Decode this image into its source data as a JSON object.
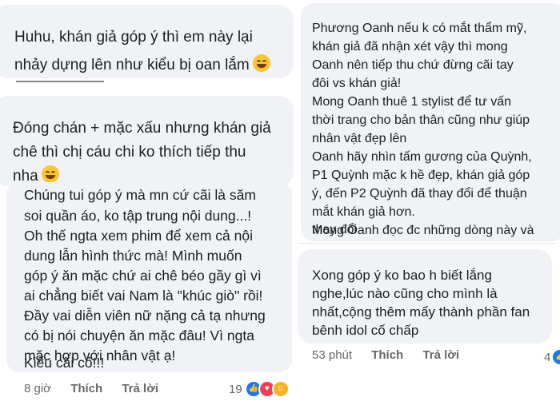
{
  "left": {
    "comment1": {
      "lines": [
        "Huhu, khán giả góp ý thì em này lại",
        "nhảy dựng lên như kiểu bị oan lắm"
      ]
    },
    "comment2": {
      "lines": [
        "Đóng chán + mặc xấu nhưng khán giả",
        "chê thì chị cáu chi ko thích tiếp thu",
        "nha"
      ]
    },
    "comment3": {
      "lines": [
        "Chúng tui góp ý mà mn cứ cãi là săm",
        "soi quần áo, ko tập trung nội dung...!",
        "Oh thế ngta xem phim để xem cả nội",
        "dung lẫn hình thức mà! Mình muốn",
        "góp ý ăn mặc chứ ai chê béo gầy gì vì",
        "ai chẳng biết vai Nam là \"khúc giò\" rồi!",
        "Đầy vai diễn viên nữ nặng cả tạ nhưng",
        "có bị nói chuyện ăn mặc đâu! Vì ngta",
        "mặc hợp với nhân vật ạ!",
        "Kiểu cãi cố!!!"
      ],
      "meta": {
        "time": "8 giờ",
        "like": "Thích",
        "reply": "Trả lời",
        "reaction_count": "19"
      }
    }
  },
  "right": {
    "comment1": {
      "lines": [
        "Phương Oanh nếu k có mắt thẩm mỹ,",
        "khán giả đã nhận xét vậy thì mong",
        "Oanh nên tiếp thu chứ đừng cãi tay",
        "đôi vs khán giả!",
        "Mong Oanh thuê 1 stylist để tư vấn",
        "thời trang cho bản thân cũng như giúp",
        "nhân vật đẹp lên",
        "Oanh hãy nhìn tấm gương của Quỳnh,",
        "P1 Quỳnh mặc k hề đẹp, khán giả góp",
        "ý, đến P2 Quỳnh đã thay đổi để thuận",
        "mắt khán giả hơn.",
        "Mong Oanh đọc đc những dòng này và",
        "thay đổi"
      ]
    },
    "comment2": {
      "lines": [
        "Xong góp ý ko bao h biết lắng",
        "nghe,lúc nào cũng cho mình là",
        "nhất,cộng thêm mấy thành phần fan",
        "bênh idol cố chấp"
      ],
      "meta": {
        "time": "53 phút",
        "like": "Thích",
        "reply": "Trả lời",
        "reaction_count": "4"
      }
    }
  },
  "icons": [
    "grinning-sweat-emoji",
    "laughing-emoji",
    "like-reaction-icon",
    "love-reaction-icon",
    "haha-reaction-icon"
  ],
  "colors": {
    "bubble": "#f0f2f5",
    "meta": "#65676b",
    "like": "#1877f2",
    "love": "#f33e58",
    "haha": "#f7b125"
  }
}
